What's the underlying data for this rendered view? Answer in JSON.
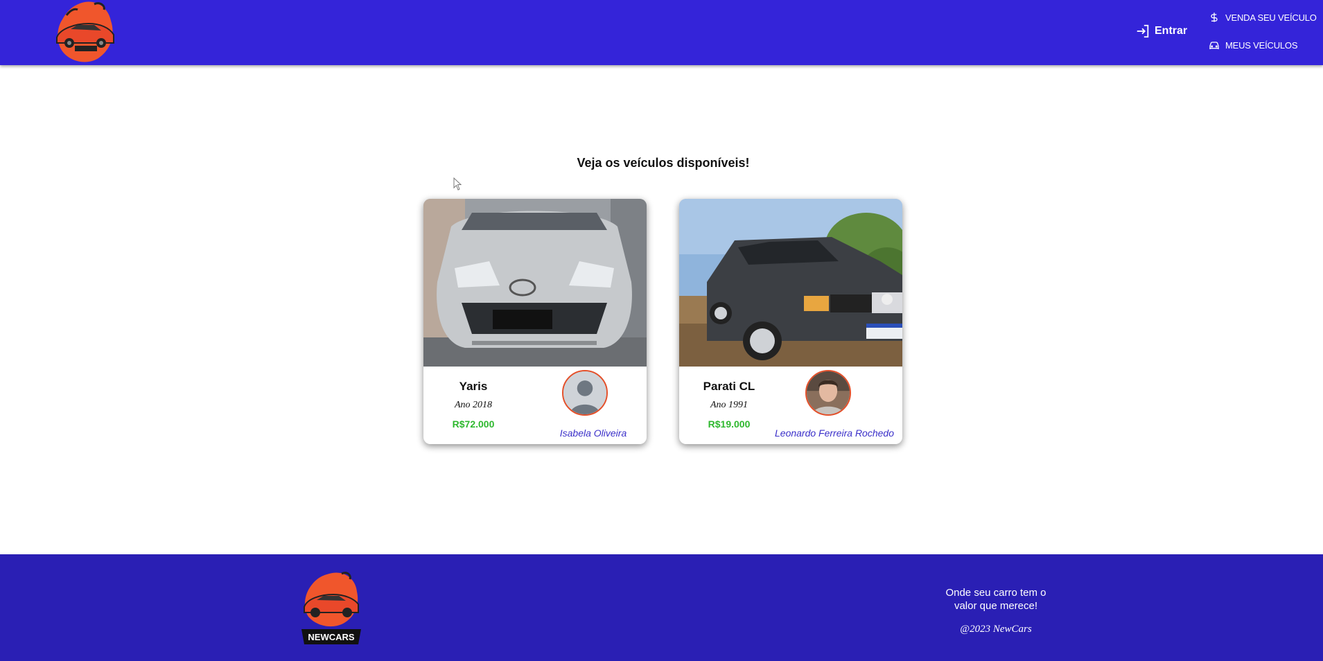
{
  "header": {
    "login_label": "Entrar",
    "nav": [
      {
        "label": "VENDA SEU VEÍCULO",
        "icon": "dollar-icon"
      },
      {
        "label": "MEUS VEÍCULOS",
        "icon": "car-icon"
      }
    ],
    "logo_icon": "newcars-logo",
    "background_color": "#3424d9"
  },
  "main": {
    "title": "Veja os veículos disponíveis!",
    "vehicles": [
      {
        "name": "Yaris",
        "year": "Ano 2018",
        "price": "R$72.000",
        "seller": "Isabela Oliveira"
      },
      {
        "name": "Parati CL",
        "year": "Ano 1991",
        "price": "R$19.000",
        "seller": "Leonardo Ferreira Rochedo"
      }
    ]
  },
  "footer": {
    "logo_text": "NEWCARS",
    "slogan": "Onde seu carro tem o valor que merece!",
    "copyright": "@2023 NewCars",
    "background_color": "#2a1fb4"
  },
  "colors": {
    "price": "#2eb82e",
    "seller": "#3a2fc9",
    "accent": "#e4502a"
  }
}
